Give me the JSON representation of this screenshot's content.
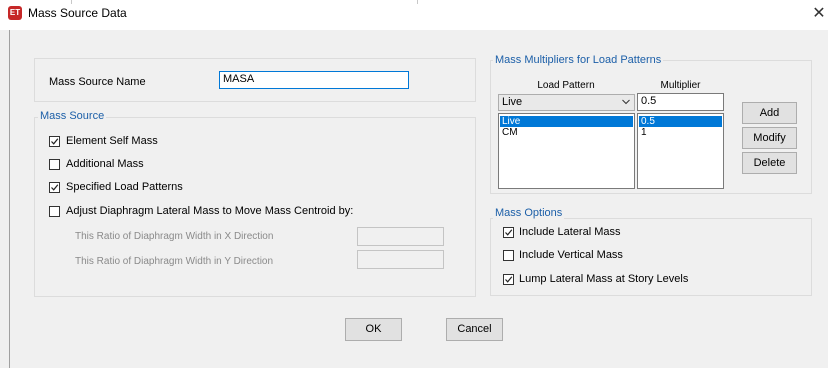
{
  "window": {
    "title": "Mass Source Data",
    "app_icon_text": "ET"
  },
  "mass_source_name": {
    "label": "Mass Source Name",
    "value": "MASA"
  },
  "mass_source": {
    "group_title": "Mass Source",
    "element_self_mass": {
      "label": "Element Self Mass",
      "checked": true
    },
    "additional_mass": {
      "label": "Additional Mass",
      "checked": false
    },
    "specified_load_patterns": {
      "label": "Specified Load Patterns",
      "checked": true
    },
    "adjust_diaphragm": {
      "label": "Adjust Diaphragm Lateral Mass to Move Mass Centroid by:",
      "checked": false
    },
    "ratio_x_label": "This Ratio of Diaphragm Width in X Direction",
    "ratio_y_label": "This Ratio of Diaphragm Width in Y Direction"
  },
  "multipliers": {
    "group_title": "Mass Multipliers for Load Patterns",
    "col_load_pattern": "Load Pattern",
    "col_multiplier": "Multiplier",
    "selected_pattern": "Live",
    "multiplier_value": "0.5",
    "rows": [
      {
        "pattern": "Live",
        "multiplier": "0.5",
        "selected": true
      },
      {
        "pattern": "CM",
        "multiplier": "1",
        "selected": false
      }
    ],
    "add_label": "Add",
    "modify_label": "Modify",
    "delete_label": "Delete"
  },
  "mass_options": {
    "group_title": "Mass Options",
    "include_lateral": {
      "label": "Include Lateral Mass",
      "checked": true
    },
    "include_vertical": {
      "label": "Include Vertical Mass",
      "checked": false
    },
    "lump_lateral": {
      "label": "Lump Lateral Mass at Story Levels",
      "checked": true
    }
  },
  "buttons": {
    "ok": "OK",
    "cancel": "Cancel"
  },
  "colors": {
    "group_title": "#1c5fa8",
    "selection": "#0078d7",
    "app_icon": "#c62828"
  }
}
